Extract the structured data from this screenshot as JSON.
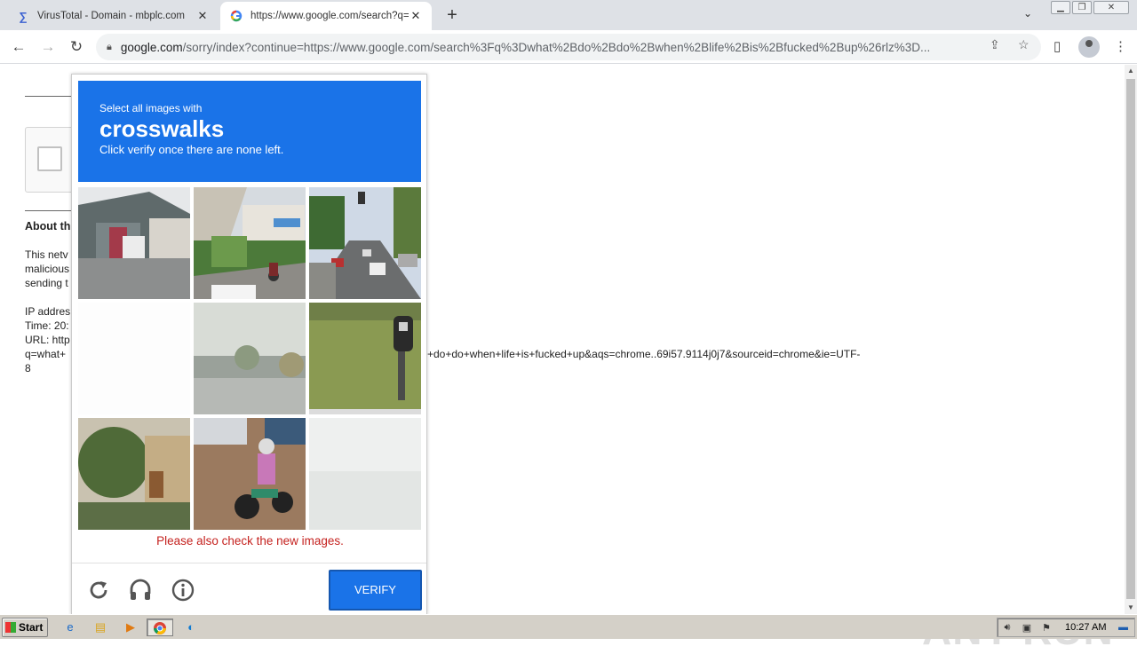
{
  "tabs": [
    {
      "title": "VirusTotal - Domain - mbplc.com",
      "icon": "virustotal-icon",
      "active": false
    },
    {
      "title": "https://www.google.com/search?q=",
      "icon": "google-icon",
      "active": true
    }
  ],
  "address_bar": {
    "host": "google.com",
    "path": "/sorry/index?continue=https://www.google.com/search%3Fq%3Dwhat%2Bdo%2Bdo%2Bwhen%2Blife%2Bis%2Bfucked%2Bup%26rlz%3D..."
  },
  "page": {
    "about_heading": "About th",
    "para1": [
      "This netv",
      "malicious",
      "sending t"
    ],
    "info_lines": [
      "IP addres",
      "Time: 20:",
      "URL: http",
      "q=what+"
    ],
    "url_tail": "+do+do+when+life+is+fucked+up&aqs=chrome..69i57.9114j0j7&sourceid=chrome&ie=UTF-",
    "url_tail2": "8"
  },
  "captcha": {
    "instruction_small": "Select all images with",
    "target": "crosswalks",
    "instruction_sub": "Click verify once there are none left.",
    "error_message": "Please also check the new images.",
    "verify_label": "VERIFY"
  },
  "taskbar": {
    "start_label": "Start",
    "clock": "10:27 AM"
  },
  "watermark": "ANY RUN",
  "colors": {
    "captcha_blue": "#1a73e8",
    "error_red": "#c5221f"
  }
}
